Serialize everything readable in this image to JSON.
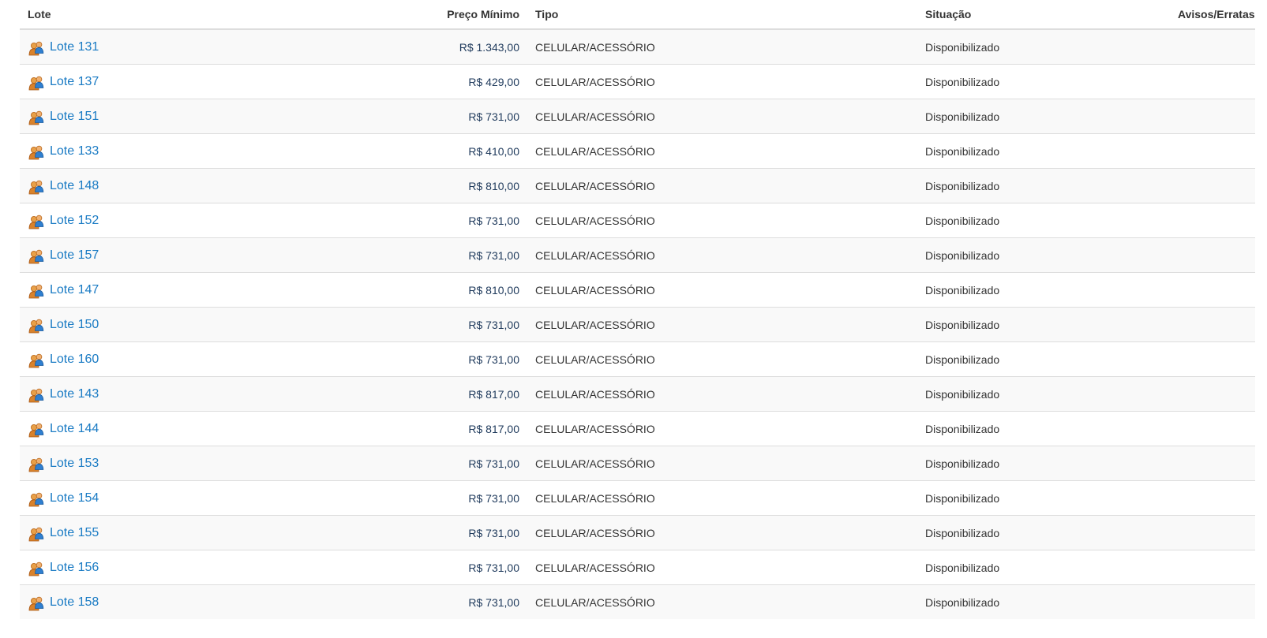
{
  "table": {
    "headers": {
      "lote": "Lote",
      "preco": "Preço Mínimo",
      "tipo": "Tipo",
      "situacao": "Situação",
      "avisos": "Avisos/Erratas"
    },
    "row_icon": "users-group-icon",
    "rows": [
      {
        "lote": "Lote 131",
        "preco": "R$ 1.343,00",
        "tipo": "CELULAR/ACESSÓRIO",
        "situacao": "Disponibilizado"
      },
      {
        "lote": "Lote 137",
        "preco": "R$ 429,00",
        "tipo": "CELULAR/ACESSÓRIO",
        "situacao": "Disponibilizado"
      },
      {
        "lote": "Lote 151",
        "preco": "R$ 731,00",
        "tipo": "CELULAR/ACESSÓRIO",
        "situacao": "Disponibilizado"
      },
      {
        "lote": "Lote 133",
        "preco": "R$ 410,00",
        "tipo": "CELULAR/ACESSÓRIO",
        "situacao": "Disponibilizado"
      },
      {
        "lote": "Lote 148",
        "preco": "R$ 810,00",
        "tipo": "CELULAR/ACESSÓRIO",
        "situacao": "Disponibilizado"
      },
      {
        "lote": "Lote 152",
        "preco": "R$ 731,00",
        "tipo": "CELULAR/ACESSÓRIO",
        "situacao": "Disponibilizado"
      },
      {
        "lote": "Lote 157",
        "preco": "R$ 731,00",
        "tipo": "CELULAR/ACESSÓRIO",
        "situacao": "Disponibilizado"
      },
      {
        "lote": "Lote 147",
        "preco": "R$ 810,00",
        "tipo": "CELULAR/ACESSÓRIO",
        "situacao": "Disponibilizado"
      },
      {
        "lote": "Lote 150",
        "preco": "R$ 731,00",
        "tipo": "CELULAR/ACESSÓRIO",
        "situacao": "Disponibilizado"
      },
      {
        "lote": "Lote 160",
        "preco": "R$ 731,00",
        "tipo": "CELULAR/ACESSÓRIO",
        "situacao": "Disponibilizado"
      },
      {
        "lote": "Lote 143",
        "preco": "R$ 817,00",
        "tipo": "CELULAR/ACESSÓRIO",
        "situacao": "Disponibilizado"
      },
      {
        "lote": "Lote 144",
        "preco": "R$ 817,00",
        "tipo": "CELULAR/ACESSÓRIO",
        "situacao": "Disponibilizado"
      },
      {
        "lote": "Lote 153",
        "preco": "R$ 731,00",
        "tipo": "CELULAR/ACESSÓRIO",
        "situacao": "Disponibilizado"
      },
      {
        "lote": "Lote 154",
        "preco": "R$ 731,00",
        "tipo": "CELULAR/ACESSÓRIO",
        "situacao": "Disponibilizado"
      },
      {
        "lote": "Lote 155",
        "preco": "R$ 731,00",
        "tipo": "CELULAR/ACESSÓRIO",
        "situacao": "Disponibilizado"
      },
      {
        "lote": "Lote 156",
        "preco": "R$ 731,00",
        "tipo": "CELULAR/ACESSÓRIO",
        "situacao": "Disponibilizado"
      },
      {
        "lote": "Lote 158",
        "preco": "R$ 731,00",
        "tipo": "CELULAR/ACESSÓRIO",
        "situacao": "Disponibilizado"
      }
    ]
  },
  "colors": {
    "link": "#1a7bc4",
    "price": "#1f3a5c",
    "text": "#333333",
    "row_stripe": "#f9f9f9",
    "border": "#dddddd"
  }
}
